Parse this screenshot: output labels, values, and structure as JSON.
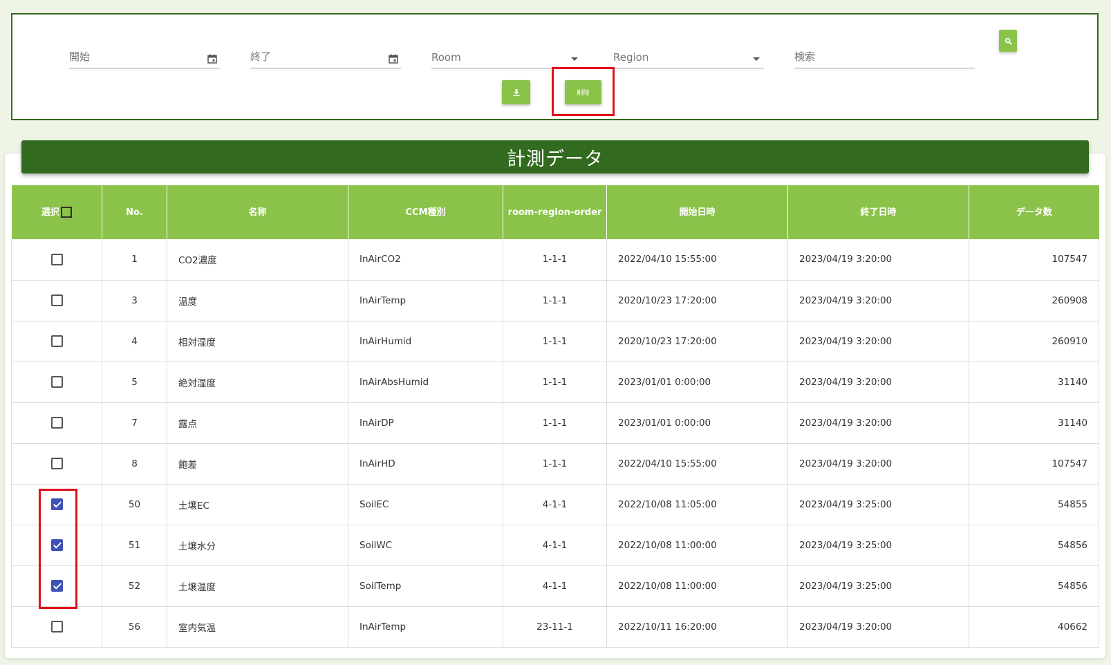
{
  "filters": {
    "start_placeholder": "開始",
    "end_placeholder": "終了",
    "room_placeholder": "Room",
    "region_placeholder": "Region",
    "search_placeholder": "検索",
    "delete_label": "削除"
  },
  "panel": {
    "title": "計測データ"
  },
  "table": {
    "headers": {
      "select": "選択",
      "no": "No.",
      "name": "名称",
      "ccm": "CCM種別",
      "rro": "room-region-order",
      "start": "開始日時",
      "end": "終了日時",
      "count": "データ数"
    },
    "rows": [
      {
        "checked": false,
        "no": "1",
        "name": "CO2濃度",
        "ccm": "InAirCO2",
        "rro": "1-1-1",
        "start": "2022/04/10 15:55:00",
        "end": "2023/04/19 3:20:00",
        "count": "107547"
      },
      {
        "checked": false,
        "no": "3",
        "name": "温度",
        "ccm": "InAirTemp",
        "rro": "1-1-1",
        "start": "2020/10/23 17:20:00",
        "end": "2023/04/19 3:20:00",
        "count": "260908"
      },
      {
        "checked": false,
        "no": "4",
        "name": "相対湿度",
        "ccm": "InAirHumid",
        "rro": "1-1-1",
        "start": "2020/10/23 17:20:00",
        "end": "2023/04/19 3:20:00",
        "count": "260910"
      },
      {
        "checked": false,
        "no": "5",
        "name": "絶対湿度",
        "ccm": "InAirAbsHumid",
        "rro": "1-1-1",
        "start": "2023/01/01 0:00:00",
        "end": "2023/04/19 3:20:00",
        "count": "31140"
      },
      {
        "checked": false,
        "no": "7",
        "name": "露点",
        "ccm": "InAirDP",
        "rro": "1-1-1",
        "start": "2023/01/01 0:00:00",
        "end": "2023/04/19 3:20:00",
        "count": "31140"
      },
      {
        "checked": false,
        "no": "8",
        "name": "飽差",
        "ccm": "InAirHD",
        "rro": "1-1-1",
        "start": "2022/04/10 15:55:00",
        "end": "2023/04/19 3:20:00",
        "count": "107547"
      },
      {
        "checked": true,
        "no": "50",
        "name": "土壌EC",
        "ccm": "SoilEC",
        "rro": "4-1-1",
        "start": "2022/10/08 11:05:00",
        "end": "2023/04/19 3:25:00",
        "count": "54855"
      },
      {
        "checked": true,
        "no": "51",
        "name": "土壌水分",
        "ccm": "SoilWC",
        "rro": "4-1-1",
        "start": "2022/10/08 11:00:00",
        "end": "2023/04/19 3:25:00",
        "count": "54856"
      },
      {
        "checked": true,
        "no": "52",
        "name": "土壌温度",
        "ccm": "SoilTemp",
        "rro": "4-1-1",
        "start": "2022/10/08 11:00:00",
        "end": "2023/04/19 3:25:00",
        "count": "54856"
      },
      {
        "checked": false,
        "no": "56",
        "name": "室内気温",
        "ccm": "InAirTemp",
        "rro": "23-11-1",
        "start": "2022/10/11 16:20:00",
        "end": "2023/04/19 3:20:00",
        "count": "40662"
      }
    ]
  },
  "colors": {
    "header_green": "#8bc34a",
    "dark_green": "#326b1f",
    "highlight_red": "#e0101b",
    "checkbox_blue": "#3f51b5"
  }
}
